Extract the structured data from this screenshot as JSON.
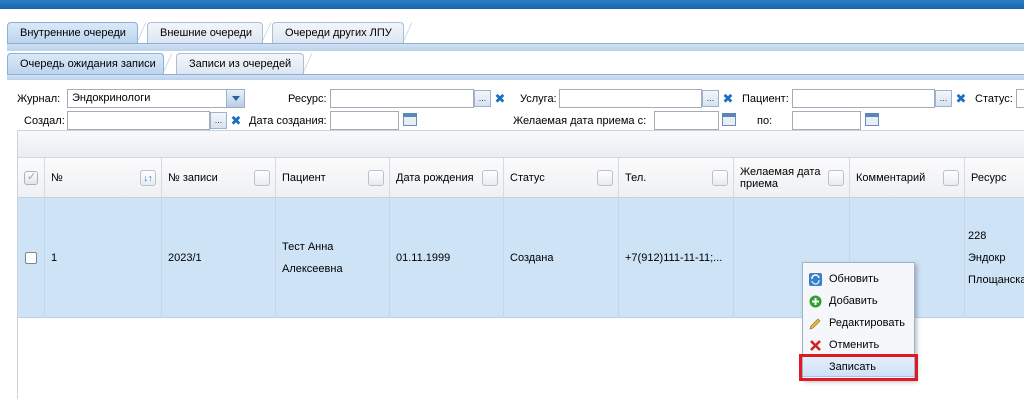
{
  "tabs_top": [
    "Внутренние очереди",
    "Внешние очереди",
    "Очереди других ЛПУ"
  ],
  "tabs_sub": [
    "Очередь ожидания записи",
    "Записи из очередей"
  ],
  "filters": {
    "journal_label": "Журнал:",
    "journal_value": "Эндокринологи",
    "resource_label": "Ресурс:",
    "service_label": "Услуга:",
    "patient_label": "Пациент:",
    "status_label": "Статус:",
    "created_by_label": "Создал:",
    "created_date_label": "Дата создания:",
    "desired_date_from_label": "Желаемая дата приема с:",
    "to_label": "по:",
    "lookup_button": "...",
    "clear_button": "✖"
  },
  "grid": {
    "columns": [
      "№",
      "№ записи",
      "Пациент",
      "Дата рождения",
      "Статус",
      "Тел.",
      "Желаемая дата приема",
      "Комментарий",
      "Ресурс"
    ],
    "row": {
      "num": "1",
      "record_no": "2023/1",
      "patient": "Тест Анна Алексеевна",
      "birth_date": "01.11.1999",
      "status": "Создана",
      "phone": "+7(912)111-11-11;...",
      "desired_date": "",
      "comment": "",
      "resource": "228 Эндокр Площанска"
    }
  },
  "context_menu": [
    "Обновить",
    "Добавить",
    "Редактировать",
    "Отменить",
    "Записать"
  ],
  "colors": {
    "accent": "#1565b0",
    "row_selected": "#cfe3f7",
    "highlight_border": "#e01a24"
  }
}
